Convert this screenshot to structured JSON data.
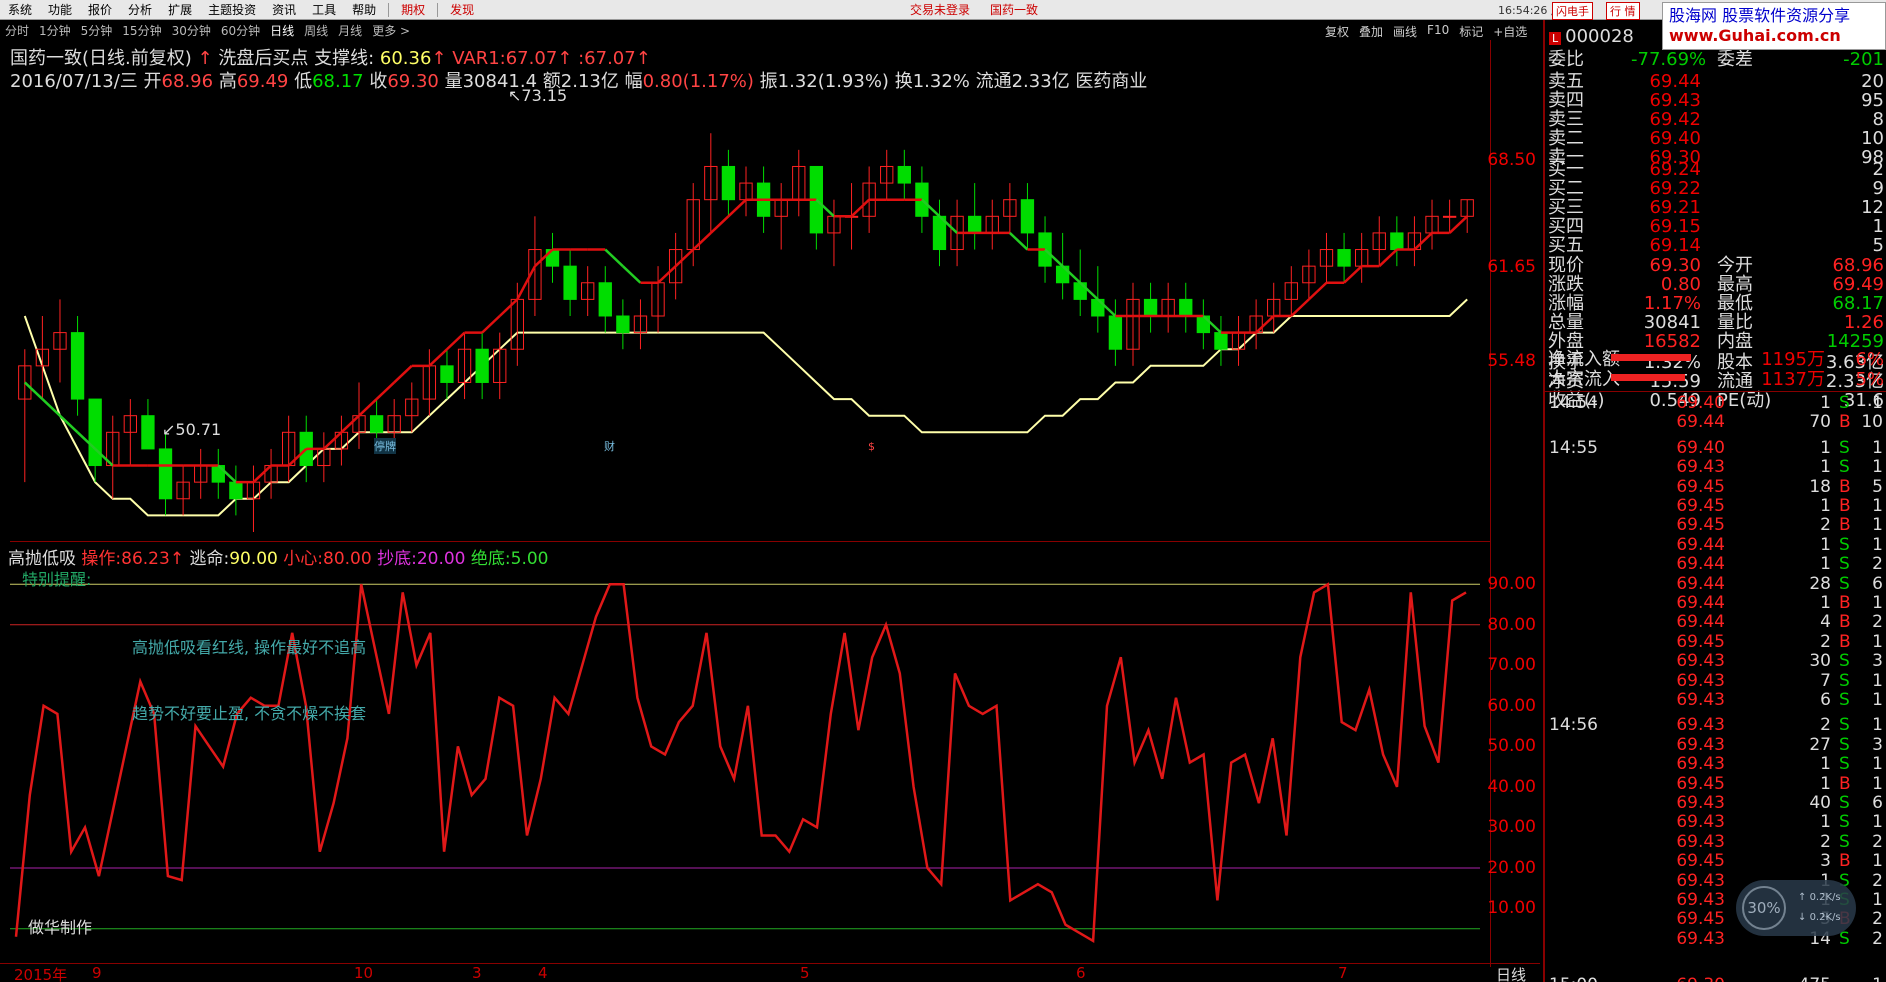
{
  "menu": {
    "items": [
      "系统",
      "功能",
      "报价",
      "分析",
      "扩展",
      "主题投资",
      "资讯",
      "工具",
      "帮助"
    ],
    "period_tab": "期权",
    "discover": "发现",
    "status": "交易未登录",
    "stock_name_top": "国药一致",
    "clock": "16:54:26 周三",
    "flash_btn": "闪电手",
    "trade_btn": "行 情"
  },
  "periods": {
    "items": [
      "分时",
      "1分钟",
      "5分钟",
      "15分钟",
      "30分钟",
      "60分钟",
      "日线",
      "周线",
      "月线",
      "更多 >"
    ],
    "active_index": 6,
    "right_tools": [
      "复权",
      "叠加",
      "画线",
      "F10",
      "标记",
      "+自选"
    ]
  },
  "header": {
    "line1_name": "国药一致(日线.前复权)",
    "line1_sep": "↑",
    "line1_title": "洗盘后买点 支撑线:",
    "support_val": "60.36",
    "var1_label": "VAR1:",
    "var1_val": "67.07",
    "var1_val2": ":67.07",
    "date": "2016/07/13/三",
    "open_label": "开",
    "open": "68.96",
    "high_label": "高",
    "high": "69.49",
    "low_label": "低",
    "low": "68.17",
    "close_label": "收",
    "close": "69.30",
    "vol_label": "量",
    "vol": "30841.4",
    "amt_label": "额",
    "amt": "2.13亿",
    "chg_label": "幅",
    "chg": "0.80(1.17%)",
    "amp_label": "振",
    "amp": "1.32(1.93%)",
    "turn_label": "换",
    "turn": "1.32%",
    "float_label": "流通",
    "float": "2.33亿",
    "industry": "医药商业"
  },
  "price_axis": [
    "68.50",
    "61.65",
    "55.48"
  ],
  "price_marks": {
    "high": "73.15",
    "low": "50.71"
  },
  "event_marks": [
    "停牌",
    "财",
    "$"
  ],
  "indicator": {
    "name": "高抛低吸",
    "op_label": "操作:",
    "op_val": "86.23",
    "escape_label": "逃命:",
    "escape_val": "90.00",
    "careful_label": "小心:",
    "careful_val": "80.00",
    "bottom_label": "抄底:",
    "bottom_val": "20.00",
    "abs_bottom_label": "绝底:",
    "abs_bottom_val": "5.00",
    "note0": "特别提醒:",
    "note1": "高抛低吸看红线, 操作最好不追高",
    "note2": "趋势不好要止盈, 不贪不燥不挨套",
    "author": "做华制作",
    "axis": [
      "90.00",
      "80.00",
      "70.00",
      "60.00",
      "50.00",
      "40.00",
      "30.00",
      "20.00",
      "10.00"
    ],
    "values": [
      3,
      38,
      60,
      58,
      24,
      30,
      18,
      34,
      50,
      66,
      58,
      18,
      17,
      55,
      50,
      45,
      58,
      62,
      60,
      60,
      78,
      60,
      24,
      36,
      52,
      90,
      74,
      58,
      88,
      70,
      78,
      24,
      50,
      38,
      42,
      62,
      60,
      28,
      42,
      62,
      58,
      70,
      82,
      90,
      90,
      62,
      50,
      48,
      56,
      60,
      78,
      50,
      42,
      60,
      28,
      28,
      24,
      32,
      30,
      58,
      78,
      54,
      72,
      80,
      68,
      40,
      20,
      16,
      68,
      60,
      58,
      60,
      12,
      14,
      16,
      14,
      6,
      4,
      2,
      60,
      72,
      46,
      54,
      42,
      62,
      46,
      48,
      12,
      46,
      48,
      36,
      52,
      28,
      72,
      88,
      90,
      56,
      54,
      64,
      48,
      40,
      88,
      55,
      46,
      86,
      88
    ]
  },
  "date_axis": {
    "labels": [
      "2015年",
      "9",
      "10",
      "3",
      "4",
      "5",
      "6",
      "7"
    ],
    "period": "日线"
  },
  "quote": {
    "code": "000028",
    "weibi_label": "委比",
    "weibi_val": "-77.69%",
    "weicha_label": "委差",
    "weicha_val": "-201",
    "asks": [
      {
        "label": "卖五",
        "price": "69.44",
        "vol": "20"
      },
      {
        "label": "卖四",
        "price": "69.43",
        "vol": "95"
      },
      {
        "label": "卖三",
        "price": "69.42",
        "vol": "8"
      },
      {
        "label": "卖二",
        "price": "69.40",
        "vol": "10"
      },
      {
        "label": "卖一",
        "price": "69.30",
        "vol": "98"
      }
    ],
    "bids": [
      {
        "label": "买一",
        "price": "69.24",
        "vol": "2"
      },
      {
        "label": "买二",
        "price": "69.22",
        "vol": "9"
      },
      {
        "label": "买三",
        "price": "69.21",
        "vol": "12"
      },
      {
        "label": "买四",
        "price": "69.15",
        "vol": "1"
      },
      {
        "label": "买五",
        "price": "69.14",
        "vol": "5"
      }
    ],
    "stats": [
      {
        "l1": "现价",
        "v1": "69.30",
        "l2": "今开",
        "v2": "68.96",
        "c1": "red",
        "c2": "red"
      },
      {
        "l1": "涨跌",
        "v1": "0.80",
        "l2": "最高",
        "v2": "69.49",
        "c1": "red",
        "c2": "red"
      },
      {
        "l1": "涨幅",
        "v1": "1.17%",
        "l2": "最低",
        "v2": "68.17",
        "c1": "red",
        "c2": "green"
      },
      {
        "l1": "总量",
        "v1": "30841",
        "l2": "量比",
        "v2": "1.26",
        "c1": "white",
        "c2": "red"
      },
      {
        "l1": "外盘",
        "v1": "16582",
        "l2": "内盘",
        "v2": "14259",
        "c1": "red",
        "c2": "green"
      },
      {
        "l1": "换手",
        "v1": "1.32%",
        "l2": "股本",
        "v2": "3.63亿",
        "c1": "white",
        "c2": "white"
      },
      {
        "l1": "净资",
        "v1": "15.59",
        "l2": "流通",
        "v2": "2.33亿",
        "c1": "white",
        "c2": "white"
      },
      {
        "l1": "收益(-)",
        "v1": "0.549",
        "l2": "PE(动)",
        "v2": "31.6",
        "c1": "white",
        "c2": "white"
      }
    ],
    "netflow_label": "净流入额",
    "netflow_val": "1195万",
    "netflow_pct": "6%",
    "block_label": "大宗流入",
    "block_val": "1137万",
    "block_pct": "5%",
    "ticks": [
      {
        "t": "14:54",
        "p": "69.40",
        "v": "1",
        "bs": "S",
        "n": "1"
      },
      {
        "t": "",
        "p": "69.44",
        "v": "70",
        "bs": "B",
        "n": "10"
      },
      {
        "t": "14:55",
        "p": "69.40",
        "v": "1",
        "bs": "S",
        "n": "1"
      },
      {
        "t": "",
        "p": "69.43",
        "v": "1",
        "bs": "S",
        "n": "1"
      },
      {
        "t": "",
        "p": "69.45",
        "v": "18",
        "bs": "B",
        "n": "5"
      },
      {
        "t": "",
        "p": "69.45",
        "v": "1",
        "bs": "B",
        "n": "1"
      },
      {
        "t": "",
        "p": "69.45",
        "v": "2",
        "bs": "B",
        "n": "1"
      },
      {
        "t": "",
        "p": "69.44",
        "v": "1",
        "bs": "S",
        "n": "1"
      },
      {
        "t": "",
        "p": "69.44",
        "v": "1",
        "bs": "S",
        "n": "2"
      },
      {
        "t": "",
        "p": "69.44",
        "v": "28",
        "bs": "S",
        "n": "6"
      },
      {
        "t": "",
        "p": "69.44",
        "v": "1",
        "bs": "B",
        "n": "1"
      },
      {
        "t": "",
        "p": "69.44",
        "v": "4",
        "bs": "B",
        "n": "2"
      },
      {
        "t": "",
        "p": "69.45",
        "v": "2",
        "bs": "B",
        "n": "1"
      },
      {
        "t": "",
        "p": "69.43",
        "v": "30",
        "bs": "S",
        "n": "3"
      },
      {
        "t": "",
        "p": "69.43",
        "v": "7",
        "bs": "S",
        "n": "1"
      },
      {
        "t": "",
        "p": "69.43",
        "v": "6",
        "bs": "S",
        "n": "1"
      },
      {
        "t": "14:56",
        "p": "69.43",
        "v": "2",
        "bs": "S",
        "n": "1"
      },
      {
        "t": "",
        "p": "69.43",
        "v": "27",
        "bs": "S",
        "n": "3"
      },
      {
        "t": "",
        "p": "69.43",
        "v": "1",
        "bs": "S",
        "n": "1"
      },
      {
        "t": "",
        "p": "69.45",
        "v": "1",
        "bs": "B",
        "n": "1"
      },
      {
        "t": "",
        "p": "69.43",
        "v": "40",
        "bs": "S",
        "n": "6"
      },
      {
        "t": "",
        "p": "69.43",
        "v": "1",
        "bs": "S",
        "n": "1"
      },
      {
        "t": "",
        "p": "69.43",
        "v": "2",
        "bs": "S",
        "n": "2"
      },
      {
        "t": "",
        "p": "69.45",
        "v": "3",
        "bs": "B",
        "n": "1"
      },
      {
        "t": "",
        "p": "69.43",
        "v": "1",
        "bs": "S",
        "n": "2"
      },
      {
        "t": "",
        "p": "69.43",
        "v": "1",
        "bs": "S",
        "n": "1"
      },
      {
        "t": "",
        "p": "69.45",
        "v": "5",
        "bs": "B",
        "n": "2"
      },
      {
        "t": "",
        "p": "69.43",
        "v": "14",
        "bs": "S",
        "n": "2"
      },
      {
        "t": "15:00",
        "p": "69.30",
        "v": "475",
        "bs": "",
        "n": "1"
      }
    ]
  },
  "ad": {
    "line1": "股海网 股票软件资源分享",
    "line2": "www.Guhai.com.cn"
  },
  "speed": {
    "pct": "30",
    "up": "0.2K/s",
    "down": "0.2K/s"
  },
  "colors": {
    "up": "#ff2222",
    "down": "#00dd00",
    "ma_red": "#e01010",
    "ma_green": "#22cc22",
    "support": "#ffffaa",
    "bg": "#000000",
    "grid": "#880000"
  },
  "chart_data": [
    {
      "type": "candlestick",
      "title": "国药一致(日线.前复权)",
      "ylim": [
        49,
        75
      ],
      "candles": [
        [
          57,
          60,
          52,
          59
        ],
        [
          59,
          62,
          57,
          60
        ],
        [
          60,
          63,
          58,
          61
        ],
        [
          61,
          62,
          56,
          57
        ],
        [
          57,
          57,
          52,
          53
        ],
        [
          53,
          56,
          51,
          55
        ],
        [
          55,
          57,
          53,
          56
        ],
        [
          56,
          57,
          54,
          54
        ],
        [
          54,
          55,
          50,
          51
        ],
        [
          51,
          53,
          50,
          52
        ],
        [
          52,
          54,
          51,
          53
        ],
        [
          53,
          54,
          51,
          52
        ],
        [
          52,
          53,
          50,
          51
        ],
        [
          51,
          53,
          49,
          52
        ],
        [
          52,
          54,
          51,
          53
        ],
        [
          53,
          56,
          52,
          55
        ],
        [
          55,
          56,
          52,
          53
        ],
        [
          53,
          55,
          52,
          54
        ],
        [
          54,
          56,
          53,
          55
        ],
        [
          55,
          58,
          54,
          56
        ],
        [
          56,
          57,
          54,
          55
        ],
        [
          55,
          57,
          54,
          56
        ],
        [
          56,
          58,
          55,
          57
        ],
        [
          57,
          60,
          56,
          59
        ],
        [
          59,
          60,
          57,
          58
        ],
        [
          58,
          61,
          57,
          60
        ],
        [
          60,
          61,
          57,
          58
        ],
        [
          58,
          61,
          57,
          60
        ],
        [
          60,
          64,
          59,
          63
        ],
        [
          63,
          68,
          62,
          66
        ],
        [
          66,
          67,
          64,
          65
        ],
        [
          65,
          66,
          62,
          63
        ],
        [
          63,
          65,
          62,
          64
        ],
        [
          64,
          65,
          61,
          62
        ],
        [
          62,
          63,
          60,
          61
        ],
        [
          61,
          63,
          60,
          62
        ],
        [
          62,
          65,
          61,
          64
        ],
        [
          64,
          67,
          63,
          66
        ],
        [
          66,
          70,
          65,
          69
        ],
        [
          69,
          73,
          67,
          71
        ],
        [
          71,
          72,
          68,
          69
        ],
        [
          69,
          71,
          68,
          70
        ],
        [
          70,
          71,
          67,
          68
        ],
        [
          68,
          70,
          66,
          69
        ],
        [
          69,
          72,
          68,
          71
        ],
        [
          71,
          71,
          66,
          67
        ],
        [
          67,
          69,
          65,
          68
        ],
        [
          68,
          70,
          66,
          68
        ],
        [
          68,
          71,
          67,
          70
        ],
        [
          70,
          72,
          69,
          71
        ],
        [
          71,
          72,
          69,
          70
        ],
        [
          70,
          71,
          67,
          68
        ],
        [
          68,
          69,
          65,
          66
        ],
        [
          66,
          69,
          65,
          68
        ],
        [
          68,
          70,
          66,
          67
        ],
        [
          67,
          69,
          66,
          68
        ],
        [
          68,
          70,
          67,
          69
        ],
        [
          69,
          70,
          66,
          67
        ],
        [
          67,
          68,
          64,
          65
        ],
        [
          65,
          67,
          63,
          64
        ],
        [
          64,
          66,
          62,
          63
        ],
        [
          63,
          65,
          61,
          62
        ],
        [
          62,
          63,
          59,
          60
        ],
        [
          60,
          64,
          59,
          63
        ],
        [
          63,
          64,
          61,
          62
        ],
        [
          62,
          64,
          61,
          63
        ],
        [
          63,
          64,
          61,
          62
        ],
        [
          62,
          63,
          60,
          61
        ],
        [
          61,
          62,
          59,
          60
        ],
        [
          60,
          62,
          59,
          61
        ],
        [
          61,
          63,
          60,
          62
        ],
        [
          62,
          64,
          61,
          63
        ],
        [
          63,
          65,
          62,
          64
        ],
        [
          64,
          66,
          63,
          65
        ],
        [
          65,
          67,
          64,
          66
        ],
        [
          66,
          67,
          64,
          65
        ],
        [
          65,
          67,
          64,
          66
        ],
        [
          66,
          68,
          65,
          67
        ],
        [
          67,
          68,
          65,
          66
        ],
        [
          66,
          68,
          65,
          67
        ],
        [
          67,
          69,
          66,
          68
        ],
        [
          68,
          69,
          67,
          68
        ],
        [
          68,
          69,
          67,
          69
        ]
      ],
      "ma_line": [
        58,
        57,
        56,
        55,
        54,
        53,
        53,
        53,
        53,
        53,
        53,
        53,
        52,
        52,
        53,
        53,
        54,
        54,
        55,
        56,
        57,
        58,
        59,
        59,
        60,
        61,
        61,
        62,
        63,
        65,
        66,
        66,
        66,
        66,
        65,
        64,
        64,
        65,
        66,
        67,
        68,
        69,
        69,
        69,
        69,
        69,
        68,
        68,
        69,
        69,
        69,
        69,
        68,
        67,
        67,
        67,
        67,
        66,
        66,
        65,
        64,
        63,
        62,
        62,
        62,
        62,
        62,
        62,
        61,
        61,
        61,
        62,
        62,
        63,
        64,
        64,
        65,
        65,
        66,
        66,
        67,
        67,
        68
      ],
      "support_line": [
        62,
        59,
        56,
        54,
        52,
        51,
        51,
        50,
        50,
        50,
        50,
        50,
        51,
        51,
        52,
        52,
        53,
        54,
        54,
        55,
        55,
        55,
        55,
        56,
        57,
        58,
        59,
        60,
        61,
        61,
        61,
        61,
        61,
        61,
        61,
        61,
        61,
        61,
        61,
        61,
        61,
        61,
        61,
        60,
        59,
        58,
        57,
        57,
        56,
        56,
        56,
        55,
        55,
        55,
        55,
        55,
        55,
        55,
        56,
        56,
        57,
        57,
        58,
        58,
        59,
        59,
        59,
        59,
        60,
        60,
        61,
        61,
        62,
        62,
        62,
        62,
        62,
        62,
        62,
        62,
        62,
        62,
        63
      ]
    },
    {
      "type": "line",
      "title": "高抛低吸",
      "ylim": [
        0,
        95
      ],
      "series": [
        {
          "name": "操作"
        }
      ],
      "ref_lines": [
        90,
        80,
        20,
        5
      ]
    }
  ]
}
